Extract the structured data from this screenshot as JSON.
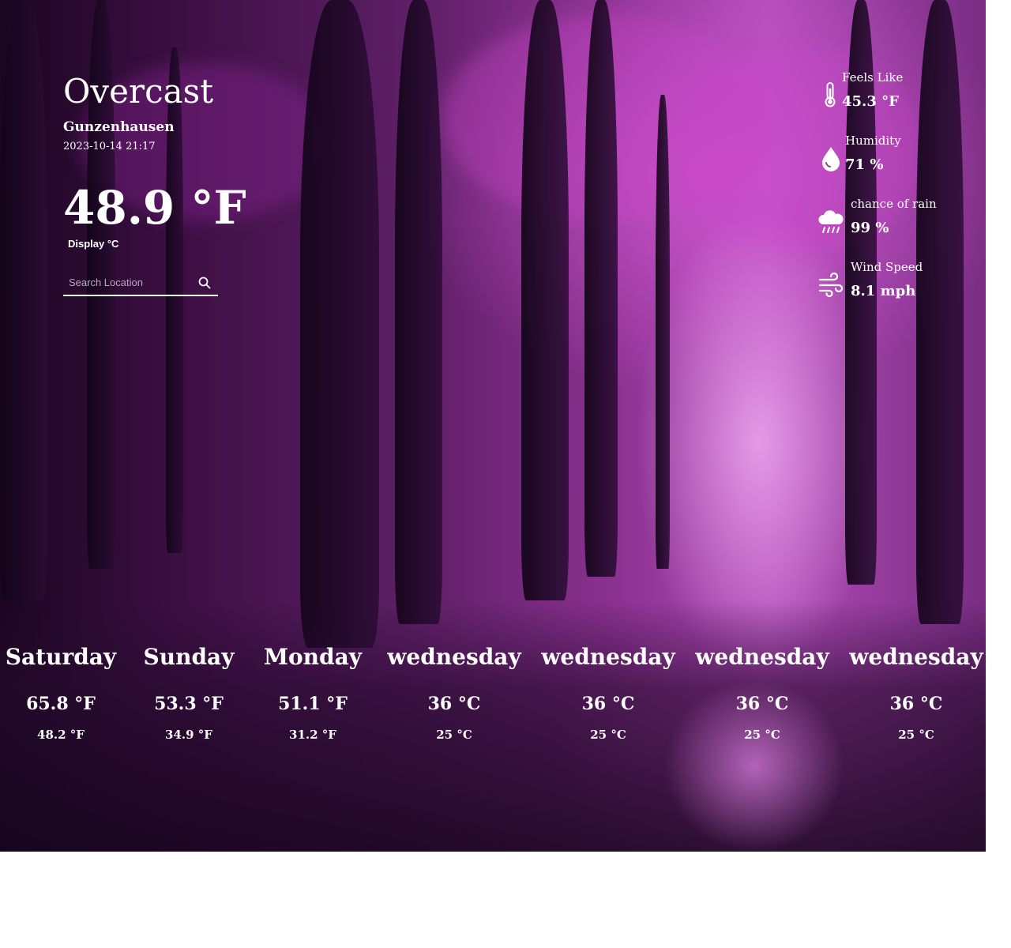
{
  "current": {
    "condition": "Overcast",
    "city": "Gunzenhausen",
    "datetime": "2023-10-14 21:17",
    "temperature": "48.9 °F",
    "unit_toggle": "Display °C"
  },
  "search": {
    "placeholder": "Search Location",
    "value": ""
  },
  "stats": {
    "feels_like": {
      "label": "Feels Like",
      "value": "45.3 °F",
      "icon": "thermometer-icon"
    },
    "humidity": {
      "label": "Humidity",
      "value": "71 %",
      "icon": "droplet-icon"
    },
    "chance_of_rain": {
      "label": "chance of rain",
      "value": "99 %",
      "icon": "rain-cloud-icon"
    },
    "wind_speed": {
      "label": "Wind Speed",
      "value": "8.1 mph",
      "icon": "wind-icon"
    }
  },
  "forecast": [
    {
      "day": "Saturday",
      "high": "65.8 °F",
      "low": "48.2 °F"
    },
    {
      "day": "Sunday",
      "high": "53.3 °F",
      "low": "34.9 °F"
    },
    {
      "day": "Monday",
      "high": "51.1 °F",
      "low": "31.2 °F"
    },
    {
      "day": "wednesday",
      "high": "36 °C",
      "low": "25 °C"
    },
    {
      "day": "wednesday",
      "high": "36 °C",
      "low": "25 °C"
    },
    {
      "day": "wednesday",
      "high": "36 °C",
      "low": "25 °C"
    },
    {
      "day": "wednesday",
      "high": "36 °C",
      "low": "25 °C"
    }
  ],
  "colors": {
    "text": "#ffffff",
    "accent": "#b14cb8"
  }
}
